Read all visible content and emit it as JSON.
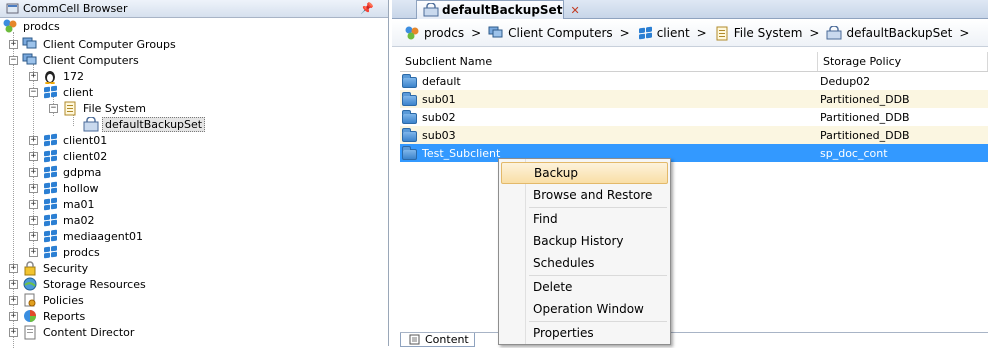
{
  "browser": {
    "title": "CommCell Browser",
    "pin_glyph": "❘",
    "tree": {
      "root": "prodcs",
      "client_computer_groups": "Client Computer Groups",
      "client_computers": "Client Computers",
      "client_172": "172",
      "client": "client",
      "file_system": "File System",
      "backupset": "defaultBackupSet",
      "client01": "client01",
      "client02": "client02",
      "gdpma": "gdpma",
      "hollow": "hollow",
      "ma01": "ma01",
      "ma02": "ma02",
      "mediaagent01": "mediaagent01",
      "prodcs_client": "prodcs",
      "security": "Security",
      "storage_resources": "Storage Resources",
      "policies": "Policies",
      "reports": "Reports",
      "content_director": "Content Director"
    }
  },
  "tab": {
    "title": "defaultBackupSet",
    "close_glyph": "✕"
  },
  "breadcrumb": {
    "items": [
      "prodcs",
      "Client Computers",
      "client",
      "File System",
      "defaultBackupSet"
    ],
    "separator": ">"
  },
  "grid": {
    "columns": [
      "Subclient Name",
      "Storage Policy"
    ],
    "rows": [
      {
        "name": "default",
        "policy": "Dedup02"
      },
      {
        "name": "sub01",
        "policy": "Partitioned_DDB"
      },
      {
        "name": "sub02",
        "policy": "Partitioned_DDB"
      },
      {
        "name": "sub03",
        "policy": "Partitioned_DDB"
      },
      {
        "name": "Test_Subclient",
        "policy": "sp_doc_cont"
      }
    ]
  },
  "bottom_tabs": {
    "content": "Content"
  },
  "context_menu": {
    "backup": "Backup",
    "browse_restore": "Browse and Restore",
    "find": "Find",
    "backup_history": "Backup History",
    "schedules": "Schedules",
    "delete": "Delete",
    "operation_window": "Operation Window",
    "properties": "Properties"
  },
  "colors": {
    "selection": "#3399ff",
    "alt_row": "#fbf6e1",
    "menu_highlight": "#f9dfa6"
  }
}
